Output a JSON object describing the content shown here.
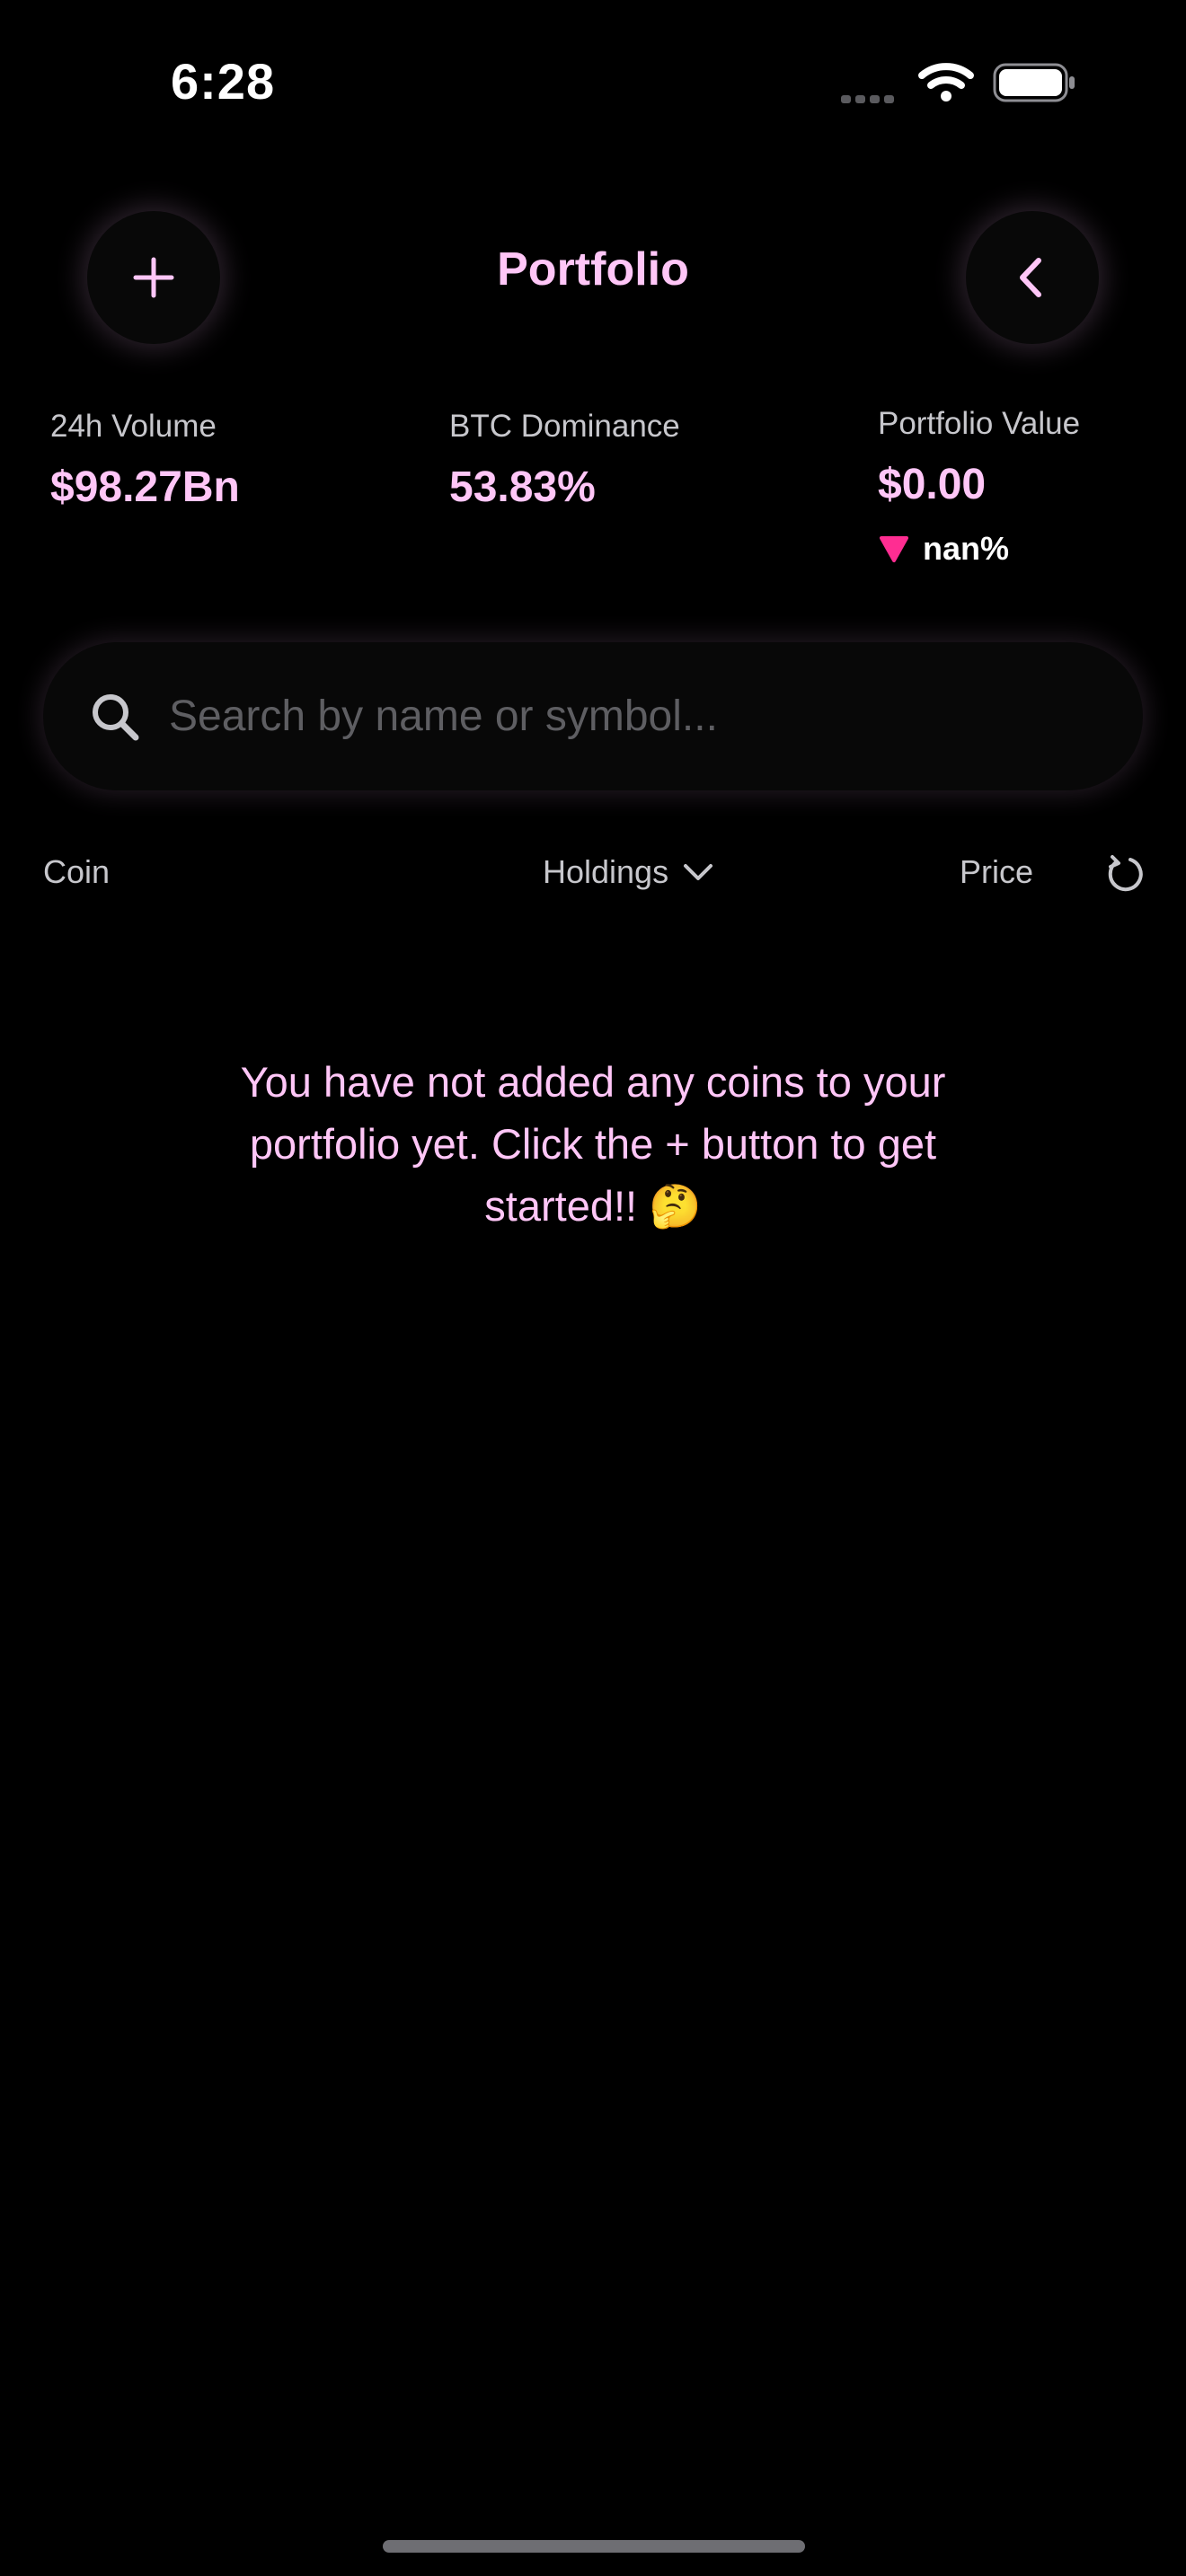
{
  "status_bar": {
    "time": "6:28",
    "icons": [
      "cellular-signal-icon",
      "wifi-icon",
      "battery-icon"
    ]
  },
  "header": {
    "title": "Portfolio",
    "add_button_icon": "plus-icon",
    "back_button_icon": "chevron-left-icon"
  },
  "stats": [
    {
      "label": "24h Volume",
      "value": "$98.27Bn"
    },
    {
      "label": "BTC Dominance",
      "value": "53.83%"
    },
    {
      "label": "Portfolio Value",
      "value": "$0.00",
      "change": "nan%",
      "change_direction": "down",
      "change_color": "#ff2d92"
    }
  ],
  "search": {
    "placeholder": "Search by name or symbol...",
    "value": "",
    "icon": "search-icon"
  },
  "columns": {
    "coin": "Coin",
    "holdings": "Holdings",
    "holdings_sort_icon": "chevron-down-icon",
    "price": "Price",
    "reload_icon": "reload-icon"
  },
  "empty_state": {
    "message": "You have not added any coins to your portfolio yet. Click the + button to get started!! 🤔"
  },
  "colors": {
    "accent": "#ffc6f7",
    "background": "#000000",
    "secondary_text": "#c7c7cc",
    "negative": "#ff2d92"
  }
}
